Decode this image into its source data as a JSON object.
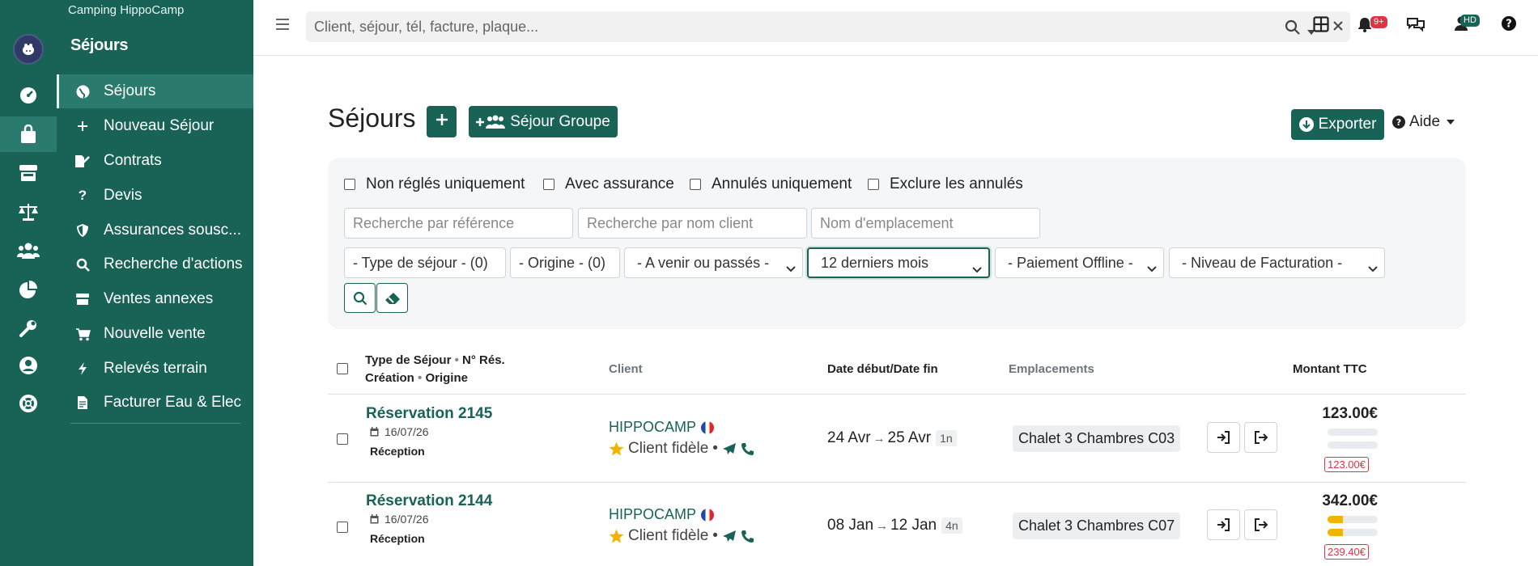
{
  "app": {
    "camping_name": "Camping HippoCamp",
    "section_title": "Séjours"
  },
  "sidebar": {
    "items": [
      {
        "label": "Séjours",
        "icon": "globe-icon",
        "active": true
      },
      {
        "label": "Nouveau Séjour",
        "icon": "plus-icon"
      },
      {
        "label": "Contrats",
        "icon": "file-signature-icon"
      },
      {
        "label": "Devis",
        "icon": "question-icon"
      },
      {
        "label": "Assurances sousc...",
        "icon": "shield-icon"
      },
      {
        "label": "Recherche d'actions",
        "icon": "search-icon"
      },
      {
        "label": "Ventes annexes",
        "icon": "store-icon"
      },
      {
        "label": "Nouvelle vente",
        "icon": "cart-icon"
      },
      {
        "label": "Relevés terrain",
        "icon": "bolt-icon"
      },
      {
        "label": "Facturer Eau & Elec",
        "icon": "invoice-icon"
      }
    ]
  },
  "topbar": {
    "search_placeholder": "Client, séjour, tél, facture, plaque...",
    "notif_badge": "9+",
    "user_initials": "HD"
  },
  "page": {
    "title": "Séjours",
    "group_button": "Séjour Groupe",
    "export_button": "Exporter",
    "help_button": "Aide"
  },
  "filters": {
    "checkboxes": [
      "Non réglés uniquement",
      "Avec assurance",
      "Annulés uniquement",
      "Exclure les annulés"
    ],
    "ref_placeholder": "Recherche par référence",
    "client_placeholder": "Recherche par nom client",
    "pitch_placeholder": "Nom d'emplacement",
    "type_select": "- Type de séjour - (0)",
    "origin_select": "- Origine - (0)",
    "time_select": "- A venir ou passés -",
    "period_select": "12 derniers mois",
    "payment_select": "- Paiement Offline -",
    "billing_select": "- Niveau de Facturation -"
  },
  "table": {
    "headers": {
      "type": "Type de Séjour",
      "num": "N° Rés.",
      "creation": "Création",
      "origin": "Origine",
      "client": "Client",
      "dates": "Date début/Date fin",
      "pitches": "Emplacements",
      "amount": "Montant TTC"
    },
    "rows": [
      {
        "title": "Réservation 2145",
        "created": "16/07/26",
        "origin": "Réception",
        "client": "HIPPOCAMP",
        "client_status": "Client fidèle",
        "start": "24 Avr",
        "end": "25 Avr",
        "nights": "1n",
        "pitch": "Chalet 3 Chambres C03",
        "amount": "123.00€",
        "paid_fraction": 0,
        "due": "123.00€"
      },
      {
        "title": "Réservation 2144",
        "created": "16/07/26",
        "origin": "Réception",
        "client": "HIPPOCAMP",
        "client_status": "Client fidèle",
        "start": "08 Jan",
        "end": "12 Jan",
        "nights": "4n",
        "pitch": "Chalet 3 Chambres C07",
        "amount": "342.00€",
        "paid_fraction": 0.3,
        "due": "239.40€"
      }
    ]
  },
  "colors": {
    "brand": "#186356",
    "danger": "#dc3545",
    "warning": "#f2b400"
  }
}
